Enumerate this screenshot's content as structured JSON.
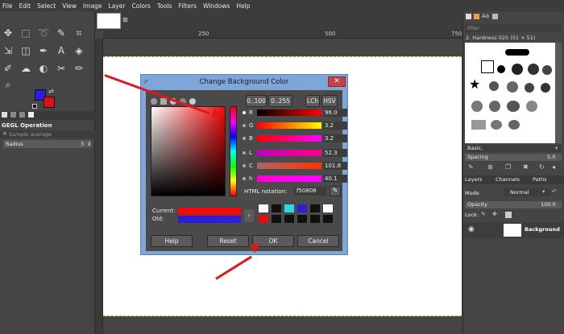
{
  "menu": [
    "File",
    "Edit",
    "Select",
    "View",
    "Image",
    "Layer",
    "Colors",
    "Tools",
    "Filters",
    "Windows",
    "Help"
  ],
  "toolbox": {
    "panel_title": "GEGL Operation",
    "search_placeholder": "Sample average",
    "radius_label": "Radius",
    "radius_value": "3",
    "fg_color": "#2d1fd6",
    "bg_color": "#e01010"
  },
  "ruler": {
    "marks": [
      "250",
      "500",
      "750"
    ]
  },
  "dialog": {
    "title": "Change Background Color",
    "range_buttons": [
      "0..100",
      "0..255"
    ],
    "mode_buttons": [
      "LCh",
      "HSV"
    ],
    "channels": [
      {
        "label": "R",
        "value": "96.0"
      },
      {
        "label": "G",
        "value": "3.2"
      },
      {
        "label": "B",
        "value": "3.2"
      },
      {
        "label": "L",
        "value": "52.3"
      },
      {
        "label": "C",
        "value": "101.8"
      },
      {
        "label": "h",
        "value": "40.1"
      }
    ],
    "html_label": "HTML notation:",
    "html_value": "f50808",
    "current_label": "Current:",
    "old_label": "Old:",
    "current_color": "#f50808",
    "old_color": "#2d1fd6",
    "buttons": {
      "help": "Help",
      "reset": "Reset",
      "ok": "OK",
      "cancel": "Cancel"
    }
  },
  "right": {
    "filter_placeholder": "filter",
    "brush_name": "2. Hardness 025 (51 × 51)",
    "brush_set": "Basic,",
    "spacing_label": "Spacing",
    "spacing_value": "5.0",
    "tabs": [
      "Layers",
      "Channels",
      "Paths"
    ],
    "mode_label": "Mode",
    "mode_value": "Normal",
    "opacity_label": "Opacity",
    "opacity_value": "100.0",
    "lock_label": "Lock:",
    "layer_name": "Background"
  }
}
